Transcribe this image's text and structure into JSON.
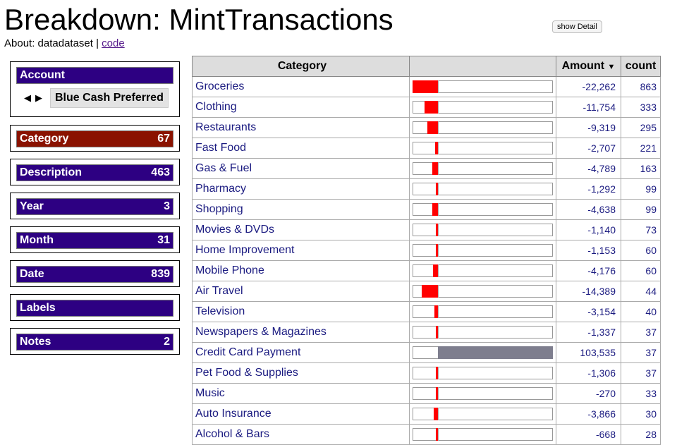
{
  "page": {
    "title": "Breakdown: MintTransactions",
    "about_prefix": "About: datadataset | ",
    "about_link": "code",
    "show_detail": "show Detail"
  },
  "account": {
    "label": "Account",
    "value": "Blue Cash Preferred",
    "prev_icon": "triangle-left-icon",
    "next_icon": "triangle-right-icon"
  },
  "dimensions": [
    {
      "label": "Category",
      "count": "67",
      "active": true
    },
    {
      "label": "Description",
      "count": "463"
    },
    {
      "label": "Year",
      "count": "3"
    },
    {
      "label": "Month",
      "count": "31"
    },
    {
      "label": "Date",
      "count": "839"
    },
    {
      "label": "Labels",
      "count": ""
    },
    {
      "label": "Notes",
      "count": "2"
    }
  ],
  "table": {
    "headers": {
      "category": "Category",
      "amount": "Amount",
      "sort_icon": "sort-desc-icon",
      "count": "count"
    },
    "bar_colors": {
      "negative": "#ff0000",
      "positive": "#7e7e8e"
    },
    "rows": [
      {
        "category": "Groceries",
        "amount": "-22,262",
        "value": -22262,
        "count": "863"
      },
      {
        "category": "Clothing",
        "amount": "-11,754",
        "value": -11754,
        "count": "333"
      },
      {
        "category": "Restaurants",
        "amount": "-9,319",
        "value": -9319,
        "count": "295"
      },
      {
        "category": "Fast Food",
        "amount": "-2,707",
        "value": -2707,
        "count": "221"
      },
      {
        "category": "Gas & Fuel",
        "amount": "-4,789",
        "value": -4789,
        "count": "163"
      },
      {
        "category": "Pharmacy",
        "amount": "-1,292",
        "value": -1292,
        "count": "99"
      },
      {
        "category": "Shopping",
        "amount": "-4,638",
        "value": -4638,
        "count": "99"
      },
      {
        "category": "Movies & DVDs",
        "amount": "-1,140",
        "value": -1140,
        "count": "73"
      },
      {
        "category": "Home Improvement",
        "amount": "-1,153",
        "value": -1153,
        "count": "60"
      },
      {
        "category": "Mobile Phone",
        "amount": "-4,176",
        "value": -4176,
        "count": "60"
      },
      {
        "category": "Air Travel",
        "amount": "-14,389",
        "value": -14389,
        "count": "44"
      },
      {
        "category": "Television",
        "amount": "-3,154",
        "value": -3154,
        "count": "40"
      },
      {
        "category": "Newspapers & Magazines",
        "amount": "-1,337",
        "value": -1337,
        "count": "37"
      },
      {
        "category": "Credit Card Payment",
        "amount": "103,535",
        "value": 103535,
        "count": "37"
      },
      {
        "category": "Pet Food & Supplies",
        "amount": "-1,306",
        "value": -1306,
        "count": "37"
      },
      {
        "category": "Music",
        "amount": "-270",
        "value": -270,
        "count": "33"
      },
      {
        "category": "Auto Insurance",
        "amount": "-3,866",
        "value": -3866,
        "count": "30"
      },
      {
        "category": "Alcohol & Bars",
        "amount": "-668",
        "value": -668,
        "count": "28"
      }
    ]
  }
}
